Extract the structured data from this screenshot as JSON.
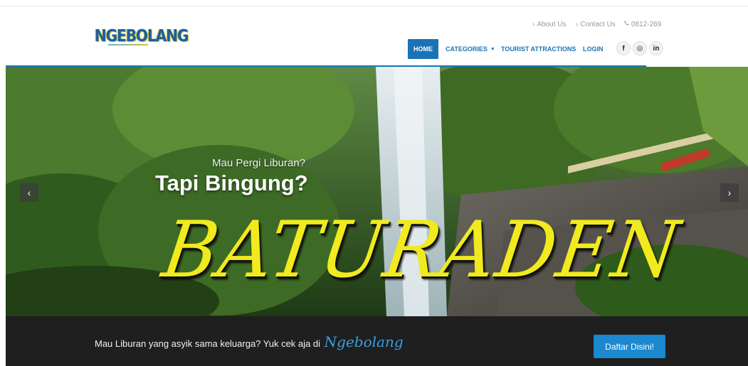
{
  "header": {
    "logo_text": "NGEBOLANG",
    "utility_links": {
      "about": "About Us",
      "contact": "Contact Us",
      "phone": "0812-269"
    },
    "nav": {
      "home": "HOME",
      "categories": "CATEGORIES",
      "tourist": "TOURIST ATTRACTIONS",
      "login": "LOGIN"
    },
    "social": {
      "facebook": "f",
      "instagram": "◎",
      "linkedin": "in"
    }
  },
  "hero": {
    "subtitle": "Mau Pergi Liburan?",
    "title": "Tapi Bingung?",
    "headline": "BATURADEN",
    "prev": "‹",
    "next": "›"
  },
  "band": {
    "text": "Mau Liburan yang asyik sama keluarga? Yuk cek aja di",
    "brand": "Ngebolang",
    "cta": "Daftar Disini!"
  },
  "colors": {
    "primary": "#1b73b5",
    "cta": "#1b88cf",
    "headline": "#f1ea1e",
    "band_bg": "#1f1f1f"
  }
}
